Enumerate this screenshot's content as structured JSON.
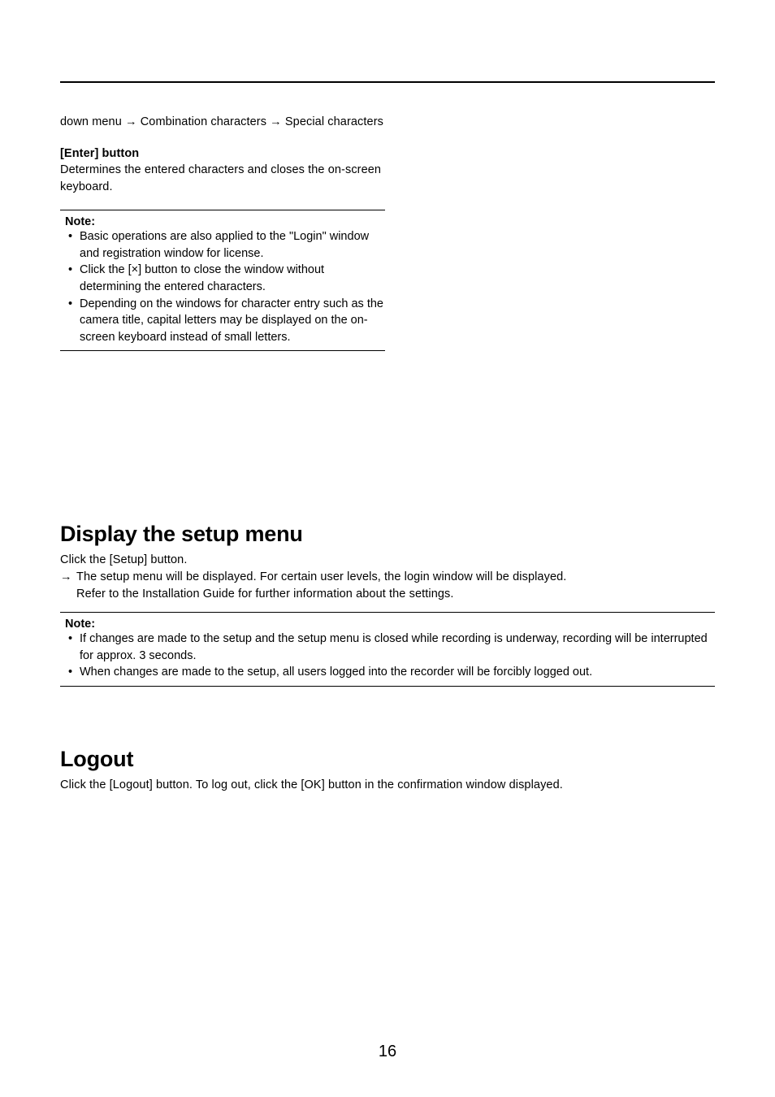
{
  "top": {
    "dropdown_text": "down menu → Combination characters → Special characters",
    "enter_button": {
      "title": "[Enter] button",
      "desc": "Determines the entered characters and closes the on-screen keyboard."
    },
    "note_label": "Note:",
    "note_items": [
      "Basic operations are also applied to the \"Login\" window and registration window for license.",
      "Click the [×] button to close the window without determining the entered characters.",
      "Depending on the windows for character entry such as the camera title, capital letters may be displayed on the on-screen keyboard instead of small letters."
    ]
  },
  "setup": {
    "heading": "Display the setup menu",
    "line1": "Click the [Setup] button.",
    "arrow": "→",
    "line2a": "The setup menu will be displayed. For certain user levels, the login window will be displayed.",
    "line2b": "Refer to the Installation Guide for further information about the settings.",
    "note_label": "Note:",
    "note_items": [
      "If changes are made to the setup and the setup menu is closed while recording is underway, recording will be interrupted for approx. 3 seconds.",
      "When changes are made to the setup, all users logged into the recorder will be forcibly logged out."
    ]
  },
  "logout": {
    "heading": "Logout",
    "text": "Click the [Logout] button. To log out, click the [OK] button in the confirmation window displayed."
  },
  "page_number": "16"
}
